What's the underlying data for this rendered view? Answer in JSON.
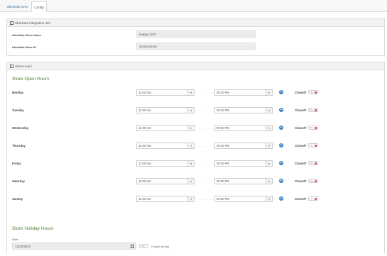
{
  "tabs": [
    {
      "label": "UberEats Sync"
    },
    {
      "label": "Config"
    }
  ],
  "integration": {
    "header": "UberEats Integration Info",
    "store_name_label": "UberEats Store Name",
    "store_name_value": "Happy Grill",
    "store_id_label": "UberEats Store ID",
    "store_id_value": "xxxxxxxxxxx"
  },
  "store_hours": {
    "header": "Store Hours",
    "title": "Store Open Hours",
    "closed_label": "Closed?",
    "toggle_text": "Yes",
    "separator": "- - - - - - - -",
    "days": [
      {
        "name": "Monday",
        "open": "11:00 AM",
        "close": "09:30 PM"
      },
      {
        "name": "Tuesday",
        "open": "11:00 AM",
        "close": "09:30 PM"
      },
      {
        "name": "Wednesday",
        "open": "11:00 AM",
        "close": "09:30 PM"
      },
      {
        "name": "Thursday",
        "open": "11:00 AM",
        "close": "09:30 PM"
      },
      {
        "name": "Friday",
        "open": "11:00 AM",
        "close": "09:30 PM"
      },
      {
        "name": "Saturday",
        "open": "11:00 AM",
        "close": "09:30 PM"
      },
      {
        "name": "Sunday",
        "open": "11:00 AM",
        "close": "09:30 PM"
      }
    ]
  },
  "holiday": {
    "title": "Store Holiday Hours",
    "date_label": "Date",
    "date_value": "12/25/2023",
    "toggle_text": "Yes",
    "closed_all_day": "Closed all day"
  },
  "colors": {
    "accent_green": "#4a7f2f",
    "plus_blue": "#3c7fc0",
    "knob_red": "#e53935"
  }
}
